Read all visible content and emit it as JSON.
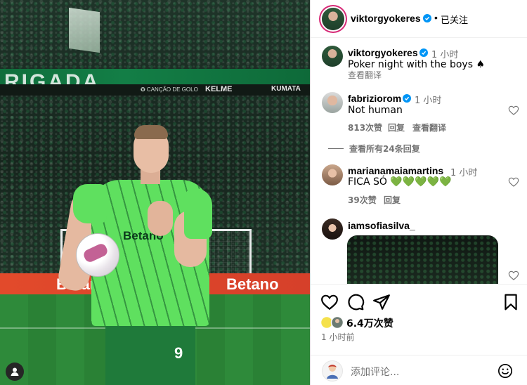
{
  "post": {
    "account": "viktorgyokeres",
    "follow_status": "已关注",
    "separator": "•"
  },
  "photo": {
    "banner_text": "RIGADA",
    "board_left": "KELME",
    "board_right": "KUMATA",
    "board_promo": "✪ CANÇÃO DE GOLO",
    "ad_left": "Betano",
    "ad_right": "Betano",
    "shirt_sponsor": "Betano",
    "shirt_number": "9"
  },
  "caption": {
    "user": "viktorgyokeres",
    "time": "1 小时",
    "text": "Poker night with the boys ♠",
    "translate": "查看翻译"
  },
  "comments": [
    {
      "user": "fabriziorom",
      "time": "1 小时",
      "text": "Not human",
      "likes": "813次赞",
      "reply": "回复",
      "translate": "查看翻译"
    },
    {
      "user": "marianamaiamartins",
      "time": "1 小时",
      "text": "FICA SÓ 💚💚💚💚💚",
      "likes": "39次赞",
      "reply": "回复"
    },
    {
      "user": "iamsofiasilva_"
    }
  ],
  "view_all_replies": "查看所有24条回复",
  "footer": {
    "likes": "6.4万次赞",
    "posted": "1 小时前",
    "comment_placeholder": "添加评论..."
  },
  "colors": {
    "verified": "#0095f6",
    "muted": "#737373",
    "story_ring": "#d62976"
  },
  "icons": [
    "heart-icon",
    "comment-icon",
    "share-icon",
    "bookmark-icon",
    "emoji-icon",
    "user-tag-icon",
    "verified-icon"
  ]
}
